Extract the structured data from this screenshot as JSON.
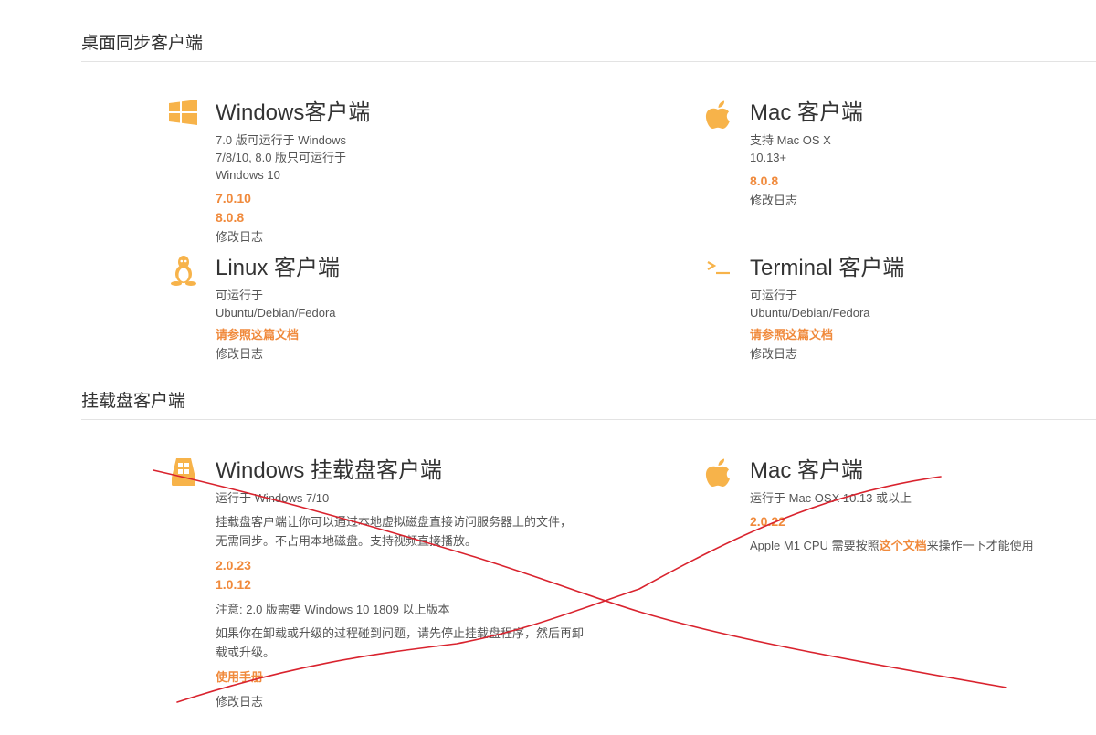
{
  "colors": {
    "accent": "#f08a3c",
    "icon": "#f7b34a",
    "annotation": "#d9232e"
  },
  "sections": {
    "desktop_title": "桌面同步客户端",
    "mount_title": "挂载盘客户端"
  },
  "desktop": {
    "windows": {
      "icon": "windows-icon",
      "title": "Windows客户端",
      "desc": "7.0 版可运行于 Windows 7/8/10, 8.0 版只可运行于 Windows 10",
      "versions": [
        "7.0.10",
        "8.0.8"
      ],
      "changelog": "修改日志"
    },
    "mac": {
      "icon": "apple-icon",
      "title": "Mac 客户端",
      "desc": "支持 Mac OS X 10.13+",
      "versions": [
        "8.0.8"
      ],
      "changelog": "修改日志"
    },
    "linux": {
      "icon": "linux-icon",
      "title": "Linux 客户端",
      "desc": "可运行于 Ubuntu/Debian/Fedora",
      "doc_link": "请参照这篇文档",
      "changelog": "修改日志"
    },
    "terminal": {
      "icon": "terminal-icon",
      "title": "Terminal 客户端",
      "desc": "可运行于 Ubuntu/Debian/Fedora",
      "doc_link": "请参照这篇文档",
      "changelog": "修改日志"
    }
  },
  "mount": {
    "windows": {
      "icon": "windows-drive-icon",
      "title": "Windows 挂载盘客户端",
      "desc": "运行于 Windows 7/10",
      "para1": "挂载盘客户端让你可以通过本地虚拟磁盘直接访问服务器上的文件，无需同步。不占用本地磁盘。支持视频直接播放。",
      "versions": [
        "2.0.23",
        "1.0.12"
      ],
      "note": "注意: 2.0 版需要 Windows 10 1809 以上版本",
      "para2": "如果你在卸载或升级的过程碰到问题，请先停止挂载盘程序，然后再卸载或升级。",
      "manual": "使用手册",
      "changelog": "修改日志"
    },
    "mac": {
      "icon": "apple-icon",
      "title": "Mac 客户端",
      "desc": "运行于 Mac OSX 10.13 或以上",
      "versions": [
        "2.0.22"
      ],
      "m1_prefix": "Apple M1 CPU 需要按照",
      "m1_link": "这个文档",
      "m1_suffix": "来操作一下才能使用"
    }
  }
}
